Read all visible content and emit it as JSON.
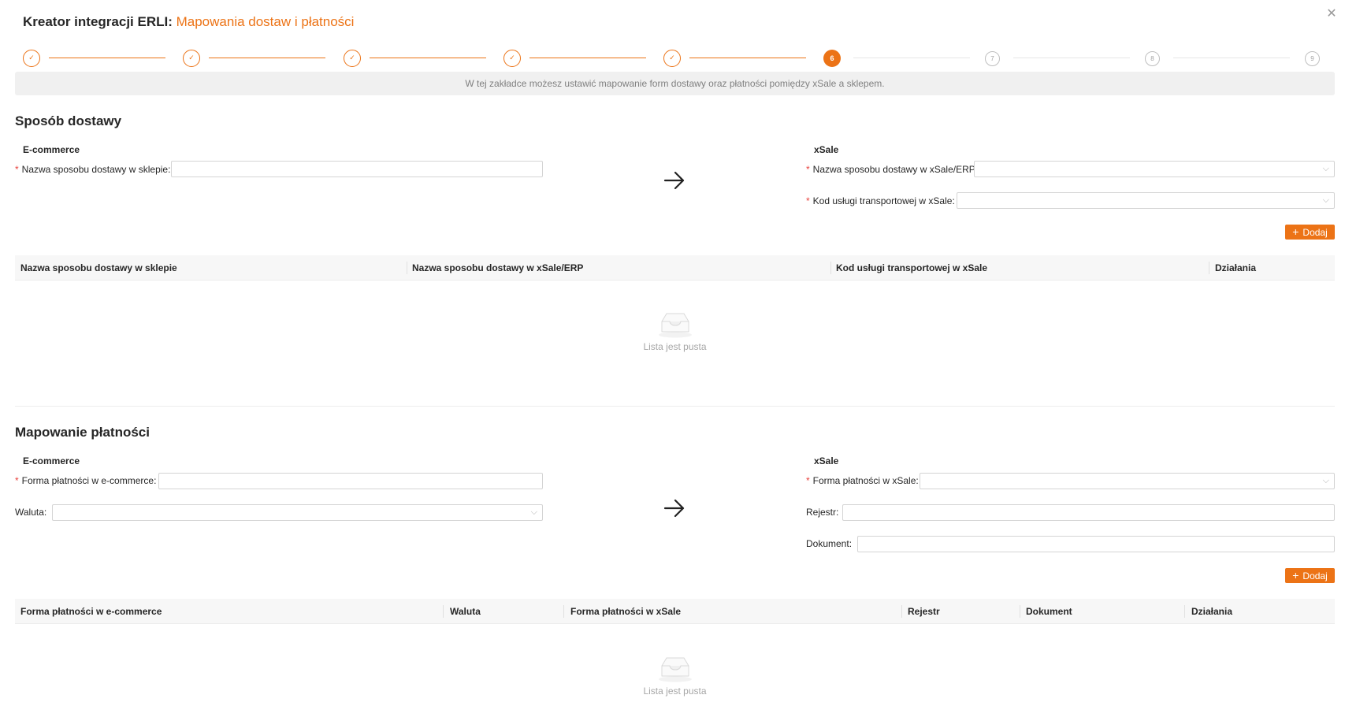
{
  "header": {
    "title_prefix": "Kreator integracji ERLI:",
    "title_accent": "Mapowania dostaw i płatności",
    "close_icon": "close-icon"
  },
  "steps": {
    "items": [
      {
        "label": "✓",
        "state": "done"
      },
      {
        "label": "✓",
        "state": "done"
      },
      {
        "label": "✓",
        "state": "done"
      },
      {
        "label": "✓",
        "state": "done"
      },
      {
        "label": "✓",
        "state": "done"
      },
      {
        "label": "6",
        "state": "active"
      },
      {
        "label": "7",
        "state": "todo"
      },
      {
        "label": "8",
        "state": "todo"
      },
      {
        "label": "9",
        "state": "todo"
      }
    ]
  },
  "info": "W tej zakładce możesz ustawić mapowanie form dostawy oraz płatności pomiędzy xSale a sklepem.",
  "delivery": {
    "title": "Sposób dostawy",
    "left_title": "E-commerce",
    "right_title": "xSale",
    "shop_name_label": "Nazwa sposobu dostawy w sklepie",
    "shop_name_value": "",
    "xsale_name_label": "Nazwa sposobu dostawy w xSale/ERP",
    "xsale_name_value": "",
    "transport_label": "Kod usługi transportowej w xSale",
    "transport_value": "",
    "add_label": "Dodaj",
    "columns": [
      "Nazwa sposobu dostawy w sklepie",
      "Nazwa sposobu dostawy w xSale/ERP",
      "Kod usługi transportowej w xSale",
      "Działania"
    ],
    "empty_text": "Lista jest pusta"
  },
  "payment": {
    "title": "Mapowanie płatności",
    "left_title": "E-commerce",
    "right_title": "xSale",
    "form_label": "Forma płatności w e-commerce",
    "form_value": "",
    "currency_label": "Waluta",
    "currency_value": "",
    "xsale_form_label": "Forma płatności w xSale",
    "xsale_form_value": "",
    "register_label": "Rejestr",
    "register_value": "",
    "document_label": "Dokument",
    "document_value": "",
    "add_label": "Dodaj",
    "columns": [
      "Forma płatności w e-commerce",
      "Waluta",
      "Forma płatności w xSale",
      "Rejestr",
      "Dokument",
      "Działania"
    ],
    "empty_text": "Lista jest pusta"
  },
  "colors": {
    "accent": "#ec7316",
    "required": "#e8423d"
  }
}
